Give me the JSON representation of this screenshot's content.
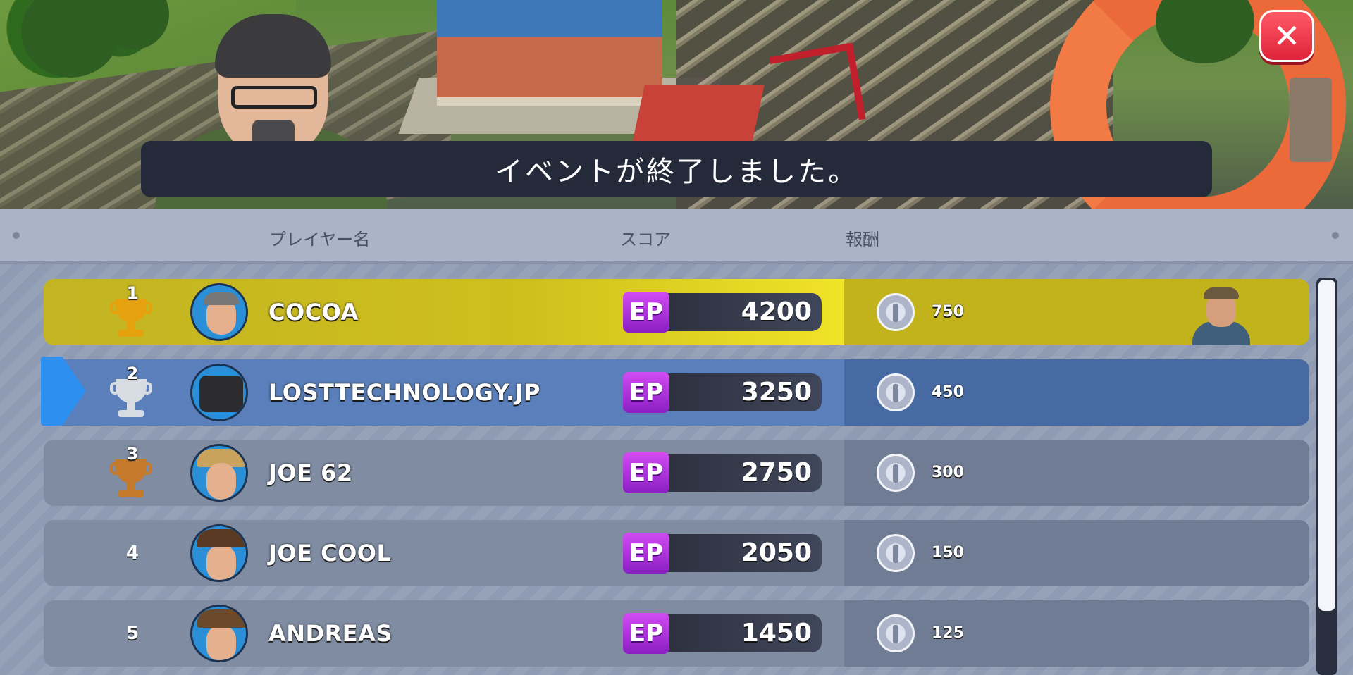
{
  "banner": {
    "title": "イベントが終了しました。"
  },
  "close": {
    "glyph": "✕",
    "icon": "close-icon"
  },
  "columns": {
    "player": "プレイヤー名",
    "score": "スコア",
    "reward": "報酬"
  },
  "score_badge": "EP",
  "rows": [
    {
      "rank": "1",
      "name": "COCOA",
      "score": "4200",
      "reward": "750",
      "trophy": "gold",
      "style": "gold"
    },
    {
      "rank": "2",
      "name": "LOSTTECHNOLOGY.JP",
      "score": "3250",
      "reward": "450",
      "trophy": "silver",
      "style": "me"
    },
    {
      "rank": "3",
      "name": "JOE 62",
      "score": "2750",
      "reward": "300",
      "trophy": "bronze",
      "style": "plain"
    },
    {
      "rank": "4",
      "name": "JOE COOL",
      "score": "2050",
      "reward": "150",
      "trophy": null,
      "style": "plain"
    },
    {
      "rank": "5",
      "name": "ANDREAS",
      "score": "1450",
      "reward": "125",
      "trophy": null,
      "style": "plain"
    }
  ],
  "colors": {
    "banner_bg": "#252a3b",
    "gold_row": "#c2b423",
    "self_row": "#5a7fba",
    "plain_row": "#7f8ca2",
    "ep_badge": "#b237e0",
    "close_button": "#e0233a"
  }
}
